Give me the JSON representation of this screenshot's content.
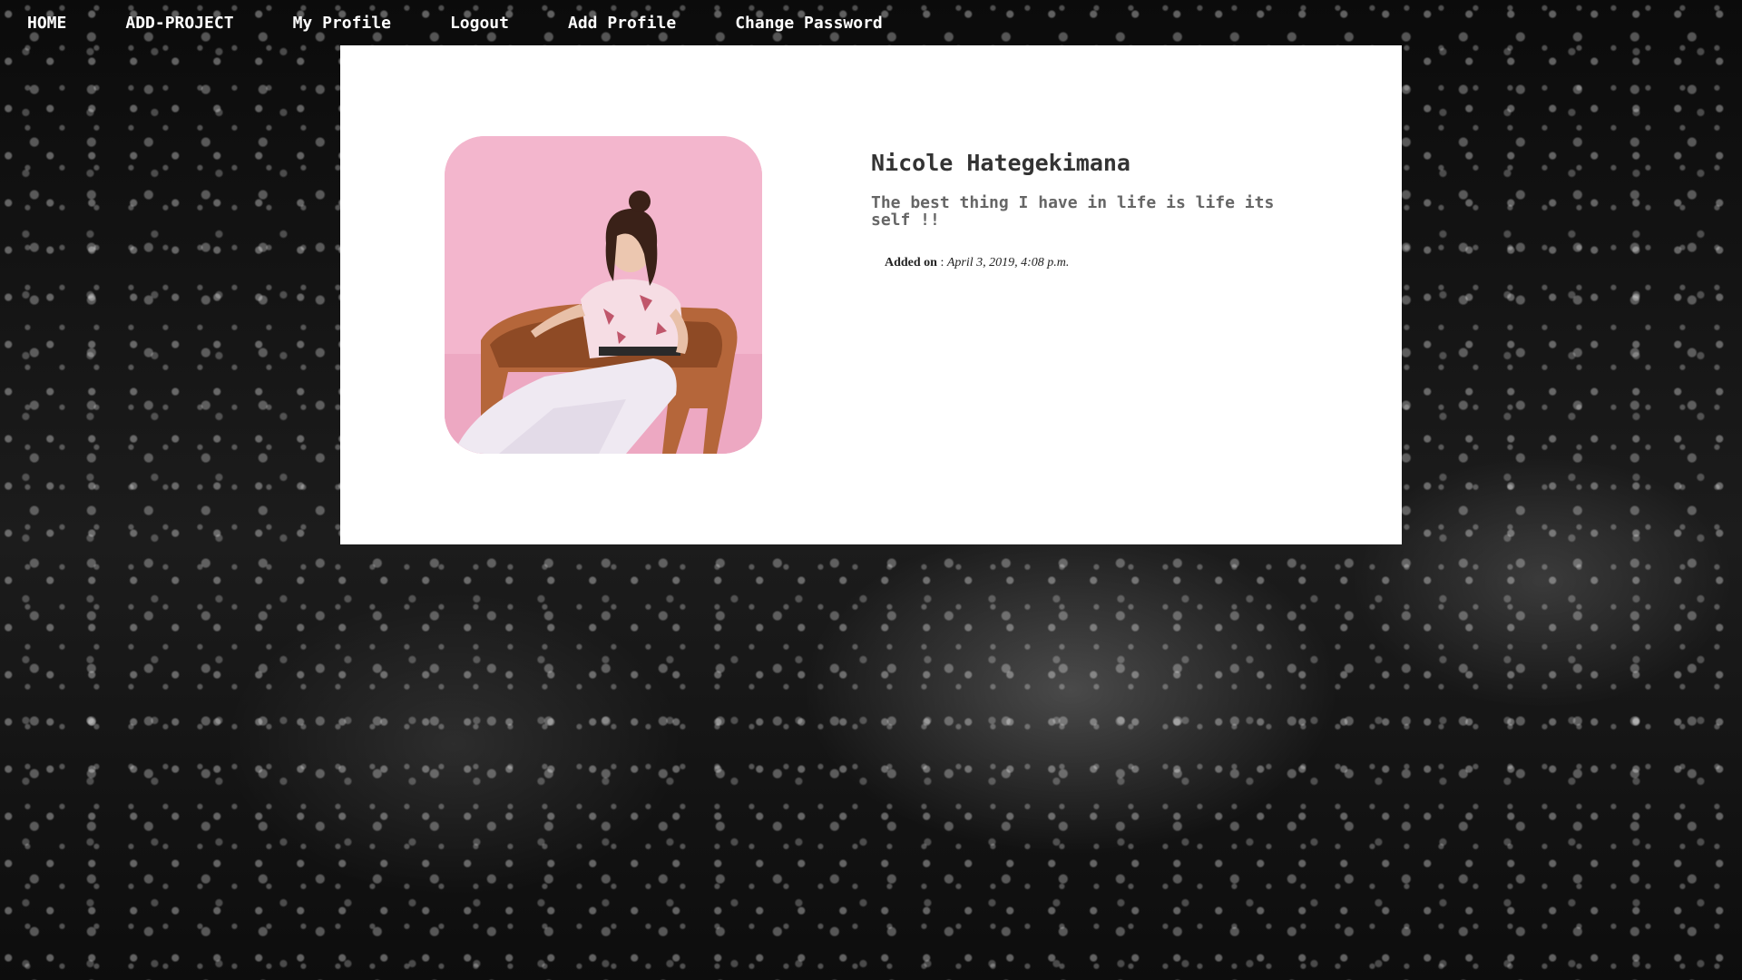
{
  "nav": {
    "items": [
      {
        "label": "HOME"
      },
      {
        "label": "ADD-PROJECT"
      },
      {
        "label": "My Profile"
      },
      {
        "label": "Logout"
      },
      {
        "label": "Add Profile"
      },
      {
        "label": "Change Password"
      }
    ]
  },
  "profile": {
    "name": "Nicole Hategekimana",
    "bio": "The best thing I have in life is life its self !!",
    "added_label": "Added on",
    "added_sep": " : ",
    "added_value": "April 3, 2019, 4:08 p.m.",
    "photo_icon": "profile-photo"
  },
  "colors": {
    "nav_text": "#ffffff",
    "card_bg": "#ffffff",
    "name_text": "#333333",
    "bio_text": "#666666",
    "photo_bg": "#f3b6cd"
  }
}
